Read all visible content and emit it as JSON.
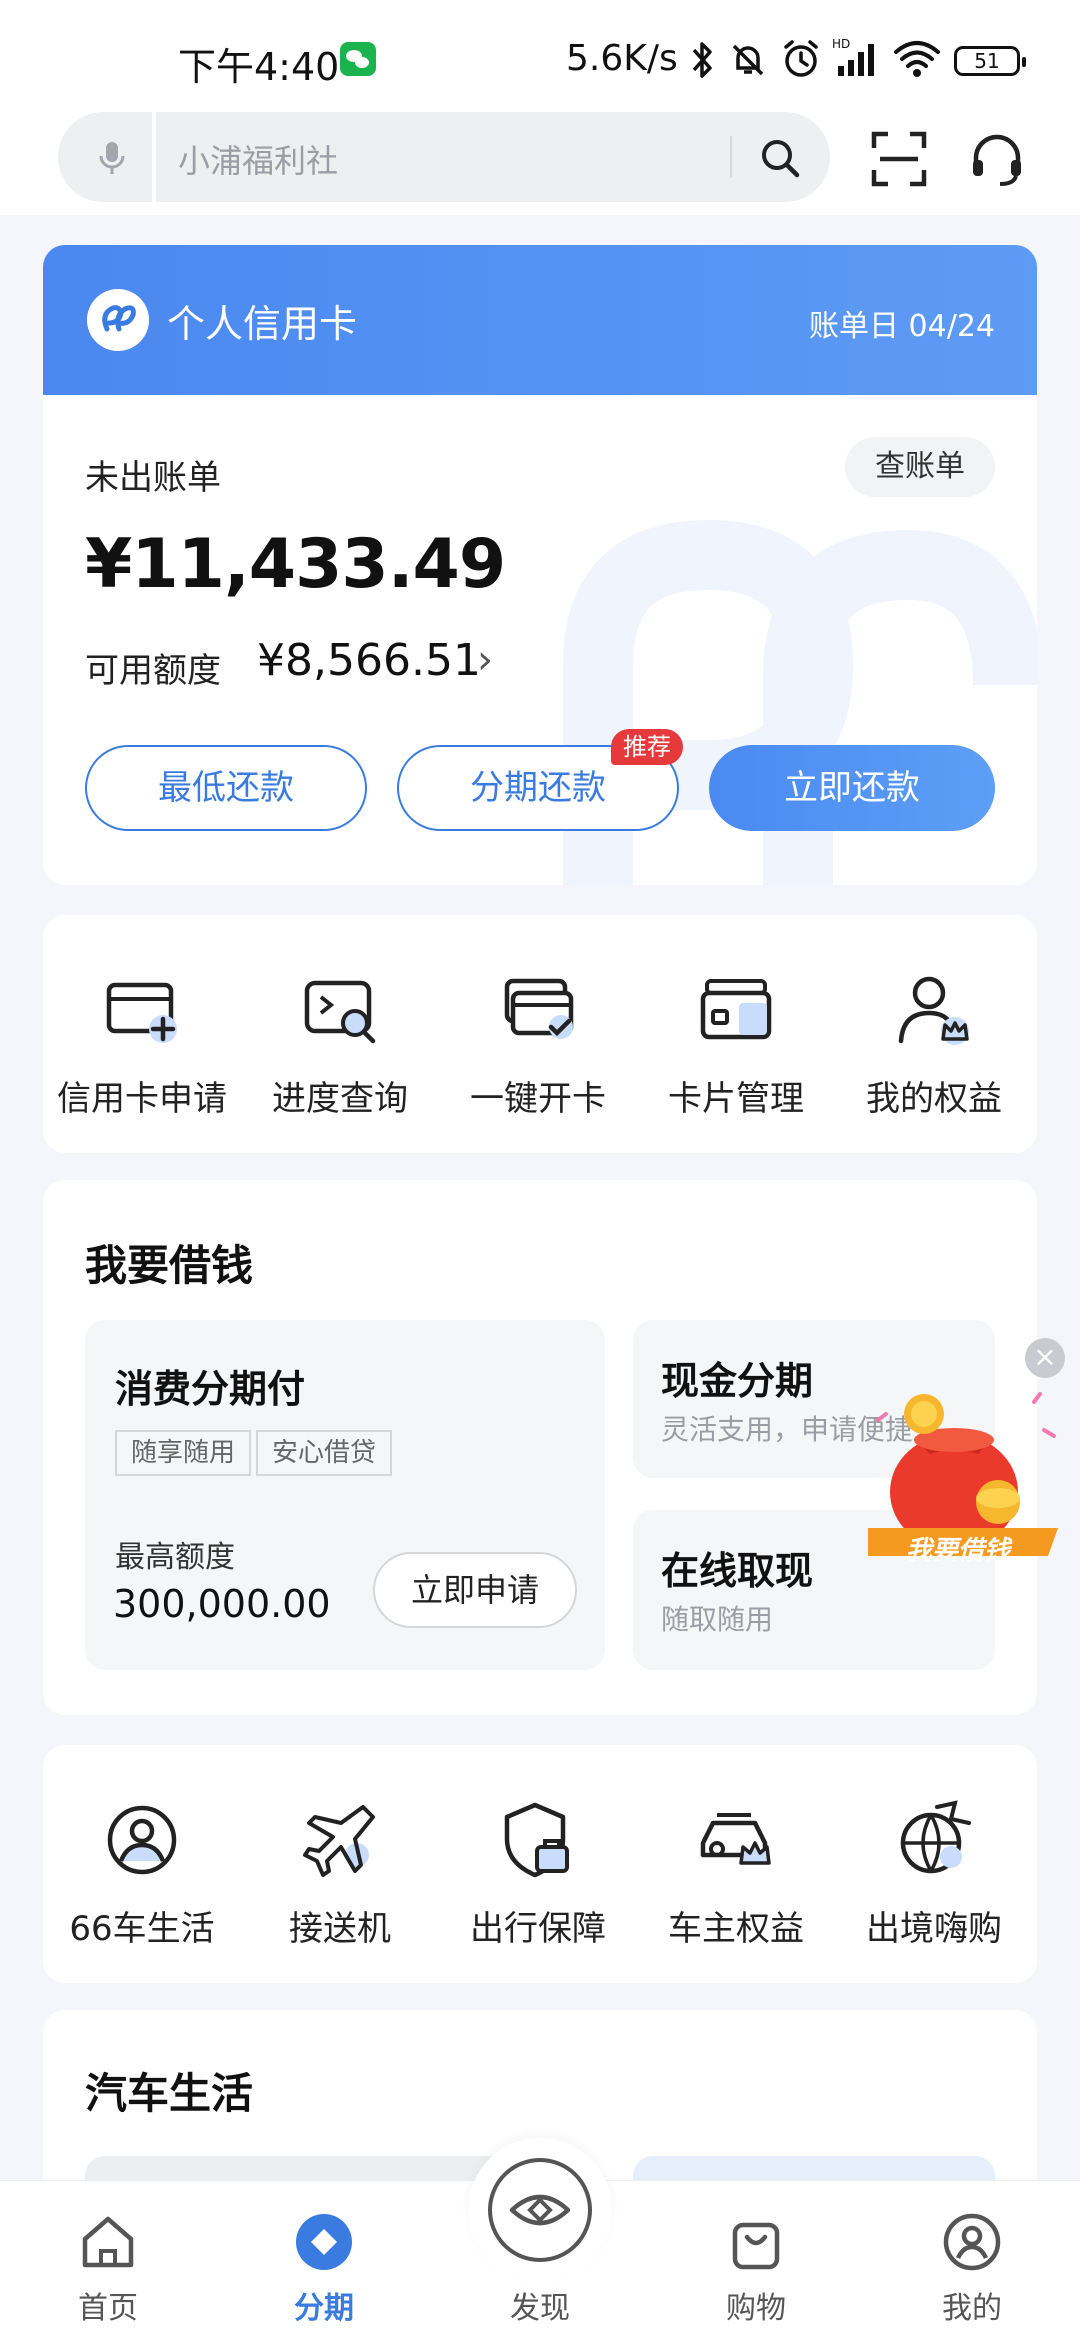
{
  "status_bar": {
    "time": "下午4:40",
    "net_speed": "5.6K/s",
    "battery": "51",
    "icons": [
      "wechat-icon",
      "bluetooth-icon",
      "mute-bell-icon",
      "alarm-icon",
      "hd-signal-icon",
      "wifi-icon",
      "battery-icon"
    ]
  },
  "header": {
    "search_placeholder": "小浦福利社",
    "icons": [
      "mic-icon",
      "search-icon",
      "scan-icon",
      "customer-service-icon"
    ]
  },
  "credit_card": {
    "title": "个人信用卡",
    "bill_day": "账单日 04/24",
    "unbilled_label": "未出账单",
    "view_bill": "查账单",
    "amount": "¥11,433.49",
    "available_label": "可用额度",
    "available_amount": "¥8,566.51",
    "chevron": "›",
    "buttons": {
      "min_pay": "最低还款",
      "installment": "分期还款",
      "pay_now": "立即还款"
    },
    "recommend_badge": "推荐"
  },
  "quick_services": [
    {
      "label": "信用卡申请",
      "icon": "card-apply-icon"
    },
    {
      "label": "进度查询",
      "icon": "progress-search-icon"
    },
    {
      "label": "一键开卡",
      "icon": "card-activate-icon"
    },
    {
      "label": "卡片管理",
      "icon": "card-manage-icon"
    },
    {
      "label": "我的权益",
      "icon": "my-rights-icon"
    }
  ],
  "loan": {
    "title": "我要借钱",
    "main": {
      "title": "消费分期付",
      "tags": [
        "随享随用",
        "安心借贷"
      ],
      "max_label": "最高额度",
      "max_amount": "300,000.00",
      "apply_button": "立即申请"
    },
    "side": [
      {
        "title": "现金分期",
        "subtitle": "灵活支用，申请便捷"
      },
      {
        "title": "在线取现",
        "subtitle": "随取随用"
      }
    ],
    "promo": {
      "label": "我要借钱",
      "close": "×"
    }
  },
  "car_services": [
    {
      "label": "66车生活",
      "icon": "car-life-avatar-icon"
    },
    {
      "label": "接送机",
      "icon": "airplane-icon"
    },
    {
      "label": "出行保障",
      "icon": "travel-shield-icon"
    },
    {
      "label": "车主权益",
      "icon": "car-rights-icon"
    },
    {
      "label": "出境嗨购",
      "icon": "globe-shopping-icon"
    }
  ],
  "car_life": {
    "title": "汽车生活"
  },
  "bottom_nav": [
    {
      "label": "首页",
      "icon": "home-icon",
      "active": false
    },
    {
      "label": "分期",
      "icon": "installment-icon",
      "active": true
    },
    {
      "label": "发现",
      "icon": "discover-eye-icon",
      "active": false
    },
    {
      "label": "购物",
      "icon": "shopping-bag-icon",
      "active": false
    },
    {
      "label": "我的",
      "icon": "profile-icon",
      "active": false
    }
  ],
  "colors": {
    "primary": "#3a7be0",
    "badge_red": "#e5393b",
    "page_bg": "#f4f6fb"
  }
}
